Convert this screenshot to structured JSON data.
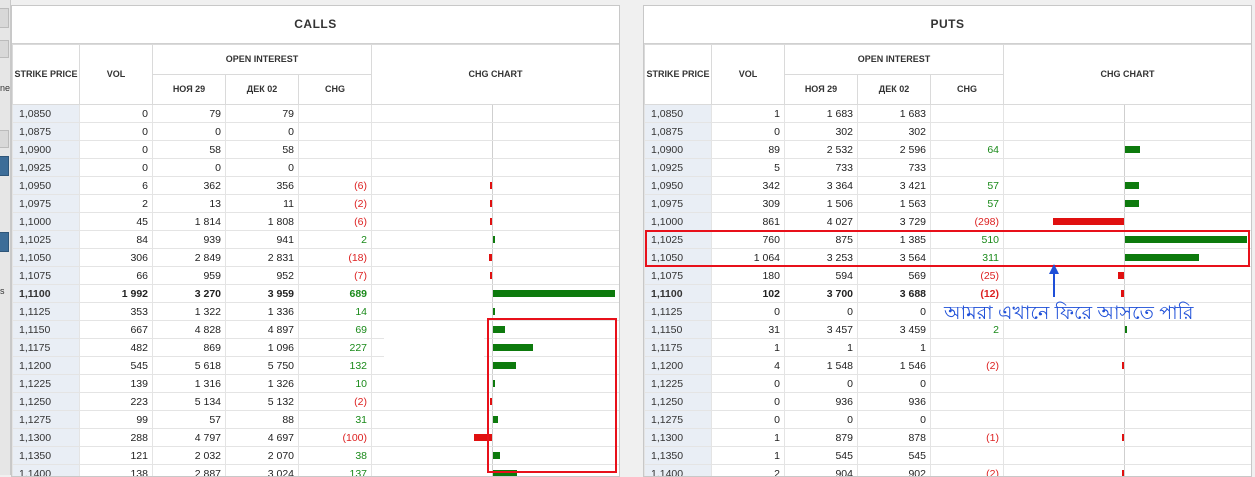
{
  "calls": {
    "title": "CALLS",
    "headers": {
      "strike": "STRIKE PRICE",
      "vol": "VOL",
      "open_interest": "OPEN INTEREST",
      "nov": "НОЯ 29",
      "dec": "ДЕК 02",
      "chg": "CHG",
      "chart": "CHG CHART"
    },
    "rows": [
      {
        "strike": "1,0850",
        "vol": "0",
        "nov": "79",
        "dec": "79",
        "chg": "",
        "sign": "none",
        "bar": 0
      },
      {
        "strike": "1,0875",
        "vol": "0",
        "nov": "0",
        "dec": "0",
        "chg": "",
        "sign": "none",
        "bar": 0
      },
      {
        "strike": "1,0900",
        "vol": "0",
        "nov": "58",
        "dec": "58",
        "chg": "",
        "sign": "none",
        "bar": 0
      },
      {
        "strike": "1,0925",
        "vol": "0",
        "nov": "0",
        "dec": "0",
        "chg": "",
        "sign": "none",
        "bar": 0
      },
      {
        "strike": "1,0950",
        "vol": "6",
        "nov": "362",
        "dec": "356",
        "chg": "(6)",
        "sign": "neg",
        "bar": -6
      },
      {
        "strike": "1,0975",
        "vol": "2",
        "nov": "13",
        "dec": "11",
        "chg": "(2)",
        "sign": "neg",
        "bar": -2
      },
      {
        "strike": "1,1000",
        "vol": "45",
        "nov": "1 814",
        "dec": "1 808",
        "chg": "(6)",
        "sign": "neg",
        "bar": -6
      },
      {
        "strike": "1,1025",
        "vol": "84",
        "nov": "939",
        "dec": "941",
        "chg": "2",
        "sign": "pos",
        "bar": 2
      },
      {
        "strike": "1,1050",
        "vol": "306",
        "nov": "2 849",
        "dec": "2 831",
        "chg": "(18)",
        "sign": "neg",
        "bar": -18
      },
      {
        "strike": "1,1075",
        "vol": "66",
        "nov": "959",
        "dec": "952",
        "chg": "(7)",
        "sign": "neg",
        "bar": -7
      },
      {
        "strike": "1,1100",
        "vol": "1 992",
        "nov": "3 270",
        "dec": "3 959",
        "chg": "689",
        "sign": "pos",
        "bar": 689,
        "bold": true
      },
      {
        "strike": "1,1125",
        "vol": "353",
        "nov": "1 322",
        "dec": "1 336",
        "chg": "14",
        "sign": "pos",
        "bar": 14
      },
      {
        "strike": "1,1150",
        "vol": "667",
        "nov": "4 828",
        "dec": "4 897",
        "chg": "69",
        "sign": "pos",
        "bar": 69
      },
      {
        "strike": "1,1175",
        "vol": "482",
        "nov": "869",
        "dec": "1 096",
        "chg": "227",
        "sign": "pos",
        "bar": 227
      },
      {
        "strike": "1,1200",
        "vol": "545",
        "nov": "5 618",
        "dec": "5 750",
        "chg": "132",
        "sign": "pos",
        "bar": 132
      },
      {
        "strike": "1,1225",
        "vol": "139",
        "nov": "1 316",
        "dec": "1 326",
        "chg": "10",
        "sign": "pos",
        "bar": 10
      },
      {
        "strike": "1,1250",
        "vol": "223",
        "nov": "5 134",
        "dec": "5 132",
        "chg": "(2)",
        "sign": "neg",
        "bar": -2
      },
      {
        "strike": "1,1275",
        "vol": "99",
        "nov": "57",
        "dec": "88",
        "chg": "31",
        "sign": "pos",
        "bar": 31
      },
      {
        "strike": "1,1300",
        "vol": "288",
        "nov": "4 797",
        "dec": "4 697",
        "chg": "(100)",
        "sign": "neg",
        "bar": -100
      },
      {
        "strike": "1,1350",
        "vol": "121",
        "nov": "2 032",
        "dec": "2 070",
        "chg": "38",
        "sign": "pos",
        "bar": 38
      },
      {
        "strike": "1,1400",
        "vol": "138",
        "nov": "2 887",
        "dec": "3 024",
        "chg": "137",
        "sign": "pos",
        "bar": 137
      }
    ]
  },
  "puts": {
    "title": "PUTS",
    "headers": {
      "strike": "STRIKE PRICE",
      "vol": "VOL",
      "open_interest": "OPEN INTEREST",
      "nov": "НОЯ 29",
      "dec": "ДЕК 02",
      "chg": "CHG",
      "chart": "CHG CHART"
    },
    "rows": [
      {
        "strike": "1,0850",
        "vol": "1",
        "nov": "1 683",
        "dec": "1 683",
        "chg": "",
        "sign": "none",
        "bar": 0
      },
      {
        "strike": "1,0875",
        "vol": "0",
        "nov": "302",
        "dec": "302",
        "chg": "",
        "sign": "none",
        "bar": 0
      },
      {
        "strike": "1,0900",
        "vol": "89",
        "nov": "2 532",
        "dec": "2 596",
        "chg": "64",
        "sign": "pos",
        "bar": 64
      },
      {
        "strike": "1,0925",
        "vol": "5",
        "nov": "733",
        "dec": "733",
        "chg": "",
        "sign": "none",
        "bar": 0
      },
      {
        "strike": "1,0950",
        "vol": "342",
        "nov": "3 364",
        "dec": "3 421",
        "chg": "57",
        "sign": "pos",
        "bar": 57
      },
      {
        "strike": "1,0975",
        "vol": "309",
        "nov": "1 506",
        "dec": "1 563",
        "chg": "57",
        "sign": "pos",
        "bar": 57
      },
      {
        "strike": "1,1000",
        "vol": "861",
        "nov": "4 027",
        "dec": "3 729",
        "chg": "(298)",
        "sign": "neg",
        "bar": -298
      },
      {
        "strike": "1,1025",
        "vol": "760",
        "nov": "875",
        "dec": "1 385",
        "chg": "510",
        "sign": "pos",
        "bar": 510
      },
      {
        "strike": "1,1050",
        "vol": "1 064",
        "nov": "3 253",
        "dec": "3 564",
        "chg": "311",
        "sign": "pos",
        "bar": 311
      },
      {
        "strike": "1,1075",
        "vol": "180",
        "nov": "594",
        "dec": "569",
        "chg": "(25)",
        "sign": "neg",
        "bar": -25
      },
      {
        "strike": "1,1100",
        "vol": "102",
        "nov": "3 700",
        "dec": "3 688",
        "chg": "(12)",
        "sign": "neg",
        "bar": -12,
        "bold": true
      },
      {
        "strike": "1,1125",
        "vol": "0",
        "nov": "0",
        "dec": "0",
        "chg": "",
        "sign": "none",
        "bar": 0
      },
      {
        "strike": "1,1150",
        "vol": "31",
        "nov": "3 457",
        "dec": "3 459",
        "chg": "2",
        "sign": "pos",
        "bar": 2
      },
      {
        "strike": "1,1175",
        "vol": "1",
        "nov": "1",
        "dec": "1",
        "chg": "",
        "sign": "none",
        "bar": 0
      },
      {
        "strike": "1,1200",
        "vol": "4",
        "nov": "1 548",
        "dec": "1 546",
        "chg": "(2)",
        "sign": "neg",
        "bar": -2
      },
      {
        "strike": "1,1225",
        "vol": "0",
        "nov": "0",
        "dec": "0",
        "chg": "",
        "sign": "none",
        "bar": 0
      },
      {
        "strike": "1,1250",
        "vol": "0",
        "nov": "936",
        "dec": "936",
        "chg": "",
        "sign": "none",
        "bar": 0
      },
      {
        "strike": "1,1275",
        "vol": "0",
        "nov": "0",
        "dec": "0",
        "chg": "",
        "sign": "none",
        "bar": 0
      },
      {
        "strike": "1,1300",
        "vol": "1",
        "nov": "879",
        "dec": "878",
        "chg": "(1)",
        "sign": "neg",
        "bar": -1
      },
      {
        "strike": "1,1350",
        "vol": "1",
        "nov": "545",
        "dec": "545",
        "chg": "",
        "sign": "none",
        "bar": 0
      },
      {
        "strike": "1,1400",
        "vol": "2",
        "nov": "904",
        "dec": "902",
        "chg": "(2)",
        "sign": "neg",
        "bar": -2
      }
    ]
  },
  "annotation": {
    "text": "আমরা এখানে ফিরে আসতে পারি"
  },
  "colors": {
    "positive_bar": "#0d7a0d",
    "negative_bar": "#e01010",
    "highlight_box": "#e8101a",
    "annotation": "#1e4fd8"
  }
}
